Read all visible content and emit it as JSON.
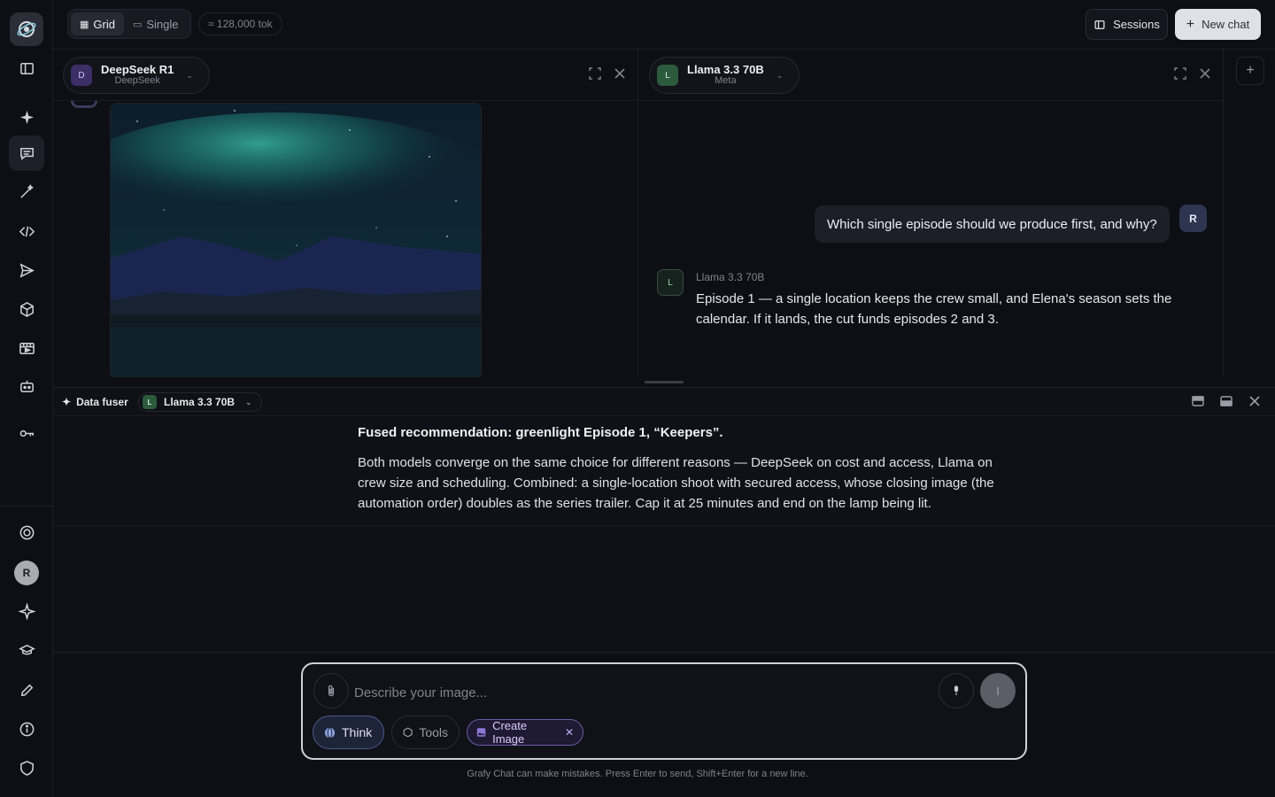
{
  "topbar": {
    "grid_label": "Grid",
    "single_label": "Single",
    "token_count": "≈ 128,000 tok",
    "sessions_label": "Sessions",
    "new_chat_label": "New chat"
  },
  "panel_left": {
    "model_name": "DeepSeek R1",
    "model_provider": "DeepSeek",
    "badge": "D",
    "badge_color": "#4b3b7a"
  },
  "panel_right": {
    "model_name": "Llama 3.3 70B",
    "model_provider": "Meta",
    "badge": "L",
    "badge_color": "#2c5a3d",
    "user_message": "Which single episode should we produce first, and why?",
    "user_avatar": "R",
    "assistant_name": "Llama 3.3 70B",
    "assistant_badge": "L",
    "assistant_message": "Episode 1 — a single location keeps the crew small, and Elena's season sets the calendar. If it lands, the cut funds episodes 2 and 3."
  },
  "fuser": {
    "title": "Data fuser",
    "model_name": "Llama 3.3 70B",
    "badge": "L",
    "heading": "Fused recommendation: greenlight Episode 1, “Keepers”.",
    "body": "Both models converge on the same choice for different reasons — DeepSeek on cost and access, Llama on crew size and scheduling. Combined: a single-location shoot with secured access, whose closing image (the automation order) doubles as the series trailer. Cap it at 25 minutes and end on the lamp being lit."
  },
  "sidebar": {
    "user_initial": "R"
  },
  "composer": {
    "placeholder": "Describe your image...",
    "think_label": "Think",
    "tools_label": "Tools",
    "create_image_label": "Create Image",
    "disclaimer": "Grafy Chat can make mistakes. Press Enter to send, Shift+Enter for a new line."
  },
  "colors": {
    "accent_think": "#4b5a8a",
    "accent_create": "#6a5aa0",
    "background": "#0d0f15"
  }
}
